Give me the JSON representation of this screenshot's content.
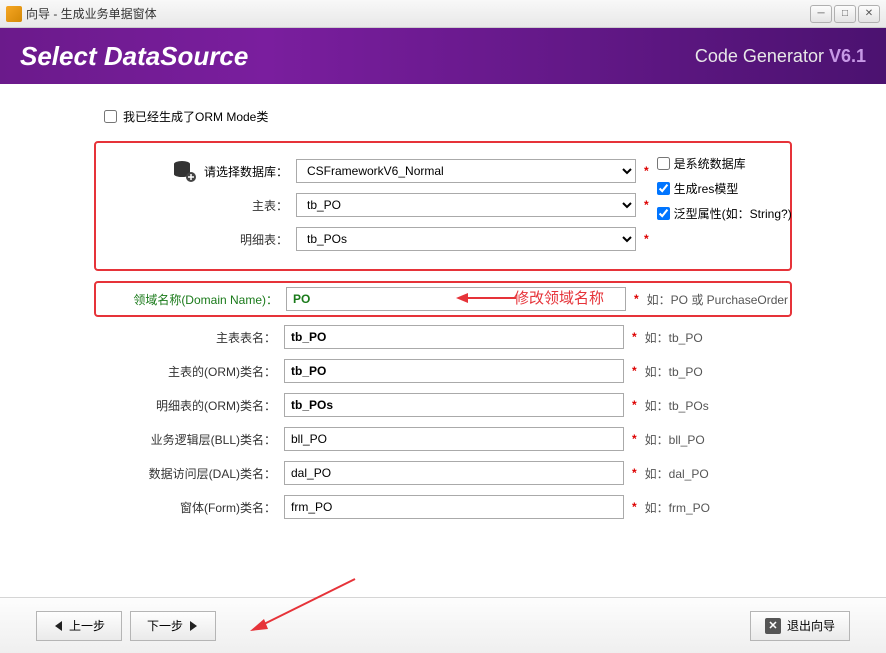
{
  "window": {
    "title": "向导 - 生成业务单据窗体"
  },
  "banner": {
    "heading": "Select DataSource",
    "brand": "Code Generator",
    "version": "V6.1"
  },
  "orm": {
    "label": "我已经生成了ORM Mode类",
    "checked": false
  },
  "db": {
    "label_database": "请选择数据库：",
    "value_database": "CSFrameworkV6_Normal",
    "label_master": "主表：",
    "value_master": "tb_PO",
    "label_detail": "明细表：",
    "value_detail": "tb_POs",
    "opt_system": "是系统数据库",
    "opt_system_checked": false,
    "opt_res": "生成res模型",
    "opt_res_checked": true,
    "opt_generic": "泛型属性(如：String?)",
    "opt_generic_checked": true
  },
  "domain": {
    "label": "领域名称(Domain Name)：",
    "value": "PO",
    "hint": "如：PO 或 PurchaseOrder",
    "annotation": "修改领域名称"
  },
  "rows": [
    {
      "label": "主表表名：",
      "value": "tb_PO",
      "hint": "如：tb_PO",
      "bold": true
    },
    {
      "label": "主表的(ORM)类名：",
      "value": "tb_PO",
      "hint": "如：tb_PO",
      "bold": true
    },
    {
      "label": "明细表的(ORM)类名：",
      "value": "tb_POs",
      "hint": "如：tb_POs",
      "bold": true
    },
    {
      "label": "业务逻辑层(BLL)类名：",
      "value": "bll_PO",
      "hint": "如：bll_PO",
      "bold": false
    },
    {
      "label": "数据访问层(DAL)类名：",
      "value": "dal_PO",
      "hint": "如：dal_PO",
      "bold": false
    },
    {
      "label": "窗体(Form)类名：",
      "value": "frm_PO",
      "hint": "如：frm_PO",
      "bold": false
    }
  ],
  "footer": {
    "prev": "上一步",
    "next": "下一步",
    "exit": "退出向导"
  },
  "asterisk": "*"
}
